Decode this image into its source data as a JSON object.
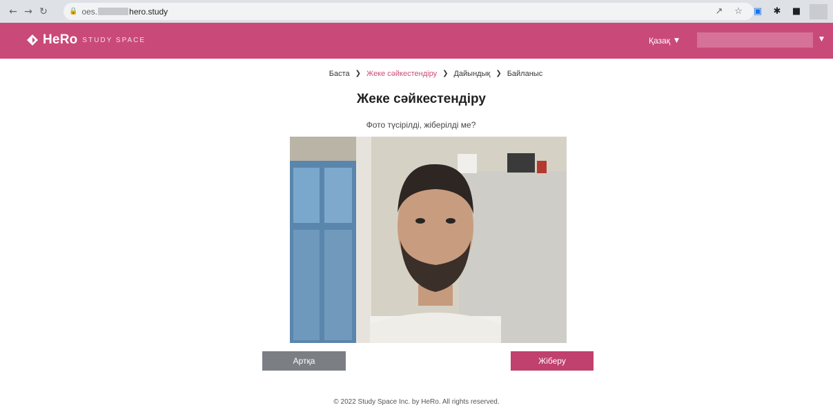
{
  "browser": {
    "url_host": "oes.",
    "url_domain": "hero.study"
  },
  "header": {
    "logo_text": "HeRo",
    "logo_sub": "STUDY SPACE",
    "language": "Қазақ",
    "brand_color": "#c94a78"
  },
  "breadcrumb": {
    "items": [
      "Баста",
      "Жеке сәйкестендіру",
      "Дайындық",
      "Байланыс"
    ],
    "active_index": 1
  },
  "main": {
    "title": "Жеке сәйкестендіру",
    "subtitle": "Фото түсірілді, жіберілді ме?"
  },
  "buttons": {
    "back_label": "Артқа",
    "send_label": "Жіберу"
  },
  "footer": {
    "text": "© 2022 Study Space Inc. by HeRo. All rights reserved."
  }
}
